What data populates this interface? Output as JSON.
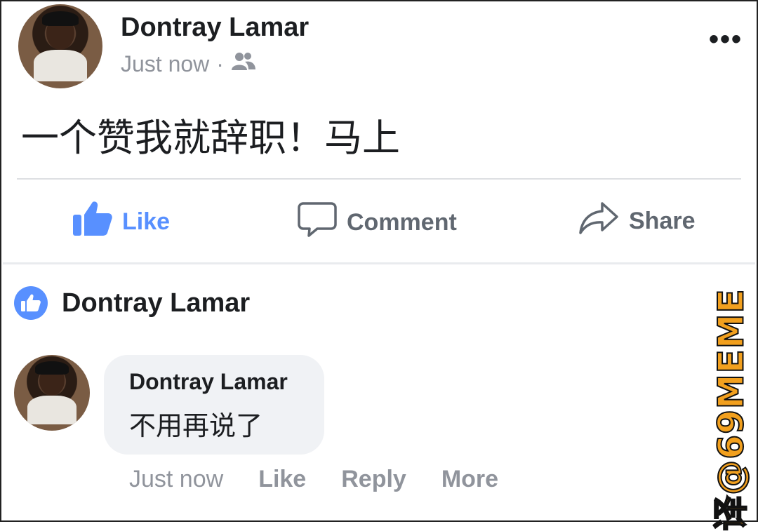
{
  "post": {
    "author": "Dontray Lamar",
    "time": "Just now",
    "separator": "·",
    "audience_icon": "friends-icon",
    "more_icon": "more-dots-icon",
    "more_glyph": "•••",
    "text": "一个赞我就辞职！马上"
  },
  "actions": {
    "like": "Like",
    "comment": "Comment",
    "share": "Share"
  },
  "likes": {
    "name": "Dontray Lamar"
  },
  "comment": {
    "author": "Dontray Lamar",
    "text": "不用再说了",
    "time": "Just now",
    "like": "Like",
    "reply": "Reply",
    "more": "More"
  },
  "watermark": "译@69MEME",
  "colors": {
    "accent": "#5890ff",
    "muted": "#90949c",
    "action_gray": "#606770",
    "bubble_bg": "#f0f2f5",
    "watermark": "#f2a01e"
  }
}
